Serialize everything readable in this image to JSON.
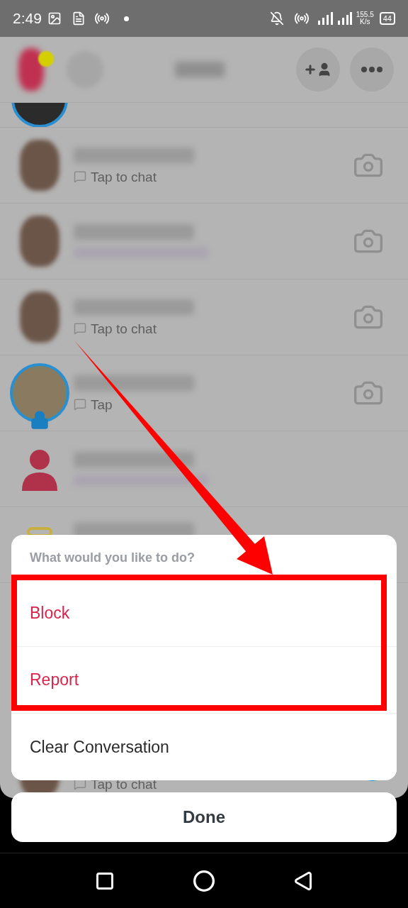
{
  "status_bar": {
    "time": "2:49",
    "speed_value": "155.5",
    "speed_unit": "K/s",
    "battery": "44"
  },
  "chat_list": [
    {
      "kind": "story"
    },
    {
      "kind": "bitmoji",
      "subtitle": "Tap to chat",
      "camera": true
    },
    {
      "kind": "bitmoji",
      "camera": true
    },
    {
      "kind": "bitmoji",
      "subtitle": "Tap to chat",
      "camera": true
    },
    {
      "kind": "story_locked",
      "subtitle": "Tap",
      "camera": true
    },
    {
      "kind": "silhouette",
      "camera": false
    },
    {
      "kind": "halo",
      "camera": false
    }
  ],
  "row_below_sheet": {
    "kind": "bitmoji",
    "subtitle": "Tap to chat"
  },
  "action_sheet": {
    "title": "What would you like to do?",
    "options": [
      {
        "label": "Block",
        "kind": "danger",
        "highlighted": true
      },
      {
        "label": "Report",
        "kind": "danger",
        "highlighted": true
      },
      {
        "label": "Clear Conversation",
        "kind": "normal",
        "highlighted": false
      }
    ]
  },
  "done_button": "Done"
}
